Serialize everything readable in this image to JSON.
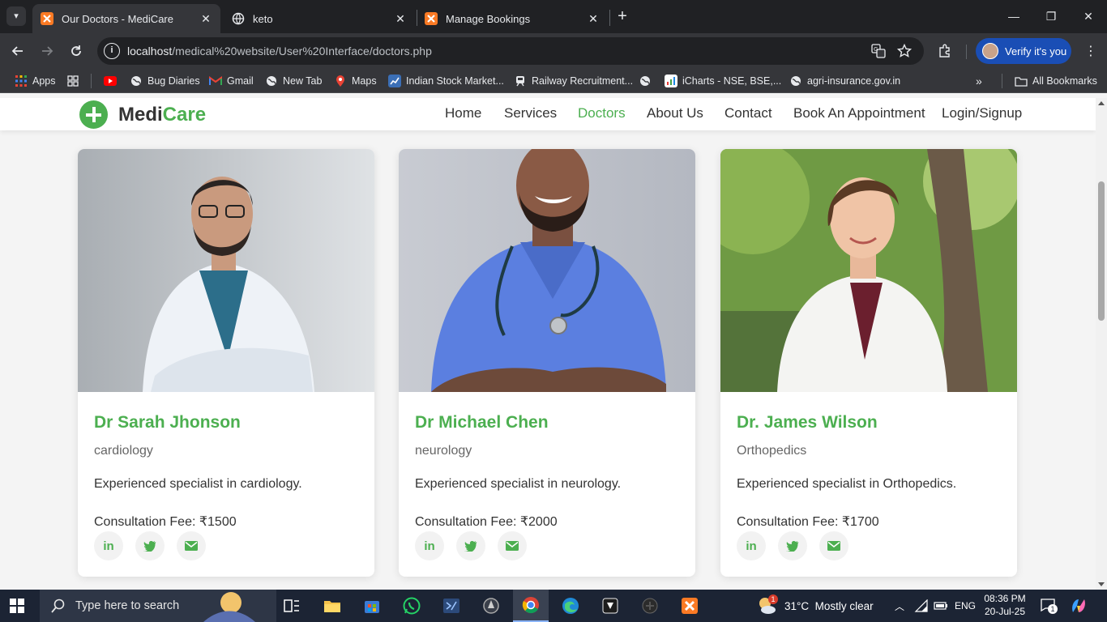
{
  "browser": {
    "tabs": [
      {
        "title": "Our Doctors - MediCare",
        "active": true,
        "favicon": "xampp-icon"
      },
      {
        "title": "keto",
        "active": false,
        "favicon": "globe-icon"
      },
      {
        "title": "Manage Bookings",
        "active": false,
        "favicon": "xampp-icon"
      }
    ],
    "url": {
      "host": "localhost",
      "path": "/medical%20website/User%20Interface/doctors.php"
    },
    "verify_label": "Verify it's you",
    "bookmarks": [
      {
        "label": "Apps",
        "icon": "apps-grid-icon"
      },
      {
        "label": "",
        "icon": "grid-icon"
      },
      {
        "label": "",
        "icon": "youtube-icon"
      },
      {
        "label": "Bug Diaries",
        "icon": "globe-icon"
      },
      {
        "label": "Gmail",
        "icon": "gmail-icon"
      },
      {
        "label": "New Tab",
        "icon": "globe-icon"
      },
      {
        "label": "Maps",
        "icon": "maps-icon"
      },
      {
        "label": "Indian Stock Market...",
        "icon": "stock-icon"
      },
      {
        "label": "Railway Recruitment...",
        "icon": "train-icon"
      },
      {
        "label": "",
        "icon": "globe-icon"
      },
      {
        "label": "iCharts - NSE, BSE,...",
        "icon": "icharts-icon"
      },
      {
        "label": "agri-insurance.gov.in",
        "icon": "globe-icon"
      }
    ],
    "all_bookmarks_label": "All Bookmarks"
  },
  "site": {
    "logo": {
      "part1": "Medi",
      "part2": "Care"
    },
    "nav": [
      {
        "label": "Home",
        "active": false
      },
      {
        "label": "Services",
        "active": false
      },
      {
        "label": "Doctors",
        "active": true
      },
      {
        "label": "About Us",
        "active": false
      },
      {
        "label": "Contact",
        "active": false
      },
      {
        "label": "Book An Appointment",
        "active": false
      },
      {
        "label": "Login/Signup",
        "active": false
      }
    ],
    "doctors": [
      {
        "name": "Dr Sarah Jhonson",
        "specialty": "cardiology",
        "description": "Experienced specialist in cardiology.",
        "fee": "Consultation Fee: ₹1500"
      },
      {
        "name": "Dr Michael Chen",
        "specialty": "neurology",
        "description": "Experienced specialist in neurology.",
        "fee": "Consultation Fee: ₹2000"
      },
      {
        "name": "Dr. James Wilson",
        "specialty": "Orthopedics",
        "description": "Experienced specialist in Orthopedics.",
        "fee": "Consultation Fee: ₹1700"
      }
    ],
    "social_icons": [
      "linkedin-icon",
      "twitter-icon",
      "email-icon"
    ],
    "colors": {
      "accent": "#4caf50",
      "text": "#333333",
      "muted": "#666666"
    }
  },
  "taskbar": {
    "search_placeholder": "Type here to search",
    "weather": "31°C  Mostly clear",
    "weather_badge": "1",
    "language": "ENG",
    "time": "08:36 PM",
    "date": "20-Jul-25",
    "notification_count": "1"
  }
}
